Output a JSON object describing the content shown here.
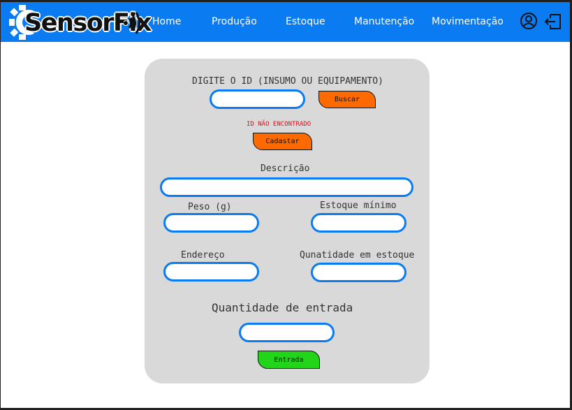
{
  "brand": {
    "name": "SensorFix"
  },
  "nav": {
    "items": [
      {
        "label": "Home"
      },
      {
        "label": "Produção"
      },
      {
        "label": "Estoque"
      },
      {
        "label": "Manutenção"
      },
      {
        "label": "Movimentação"
      }
    ],
    "icons": [
      "user-circle-icon",
      "logout-icon"
    ]
  },
  "form": {
    "id_label": "DIGITE O ID (INSUMO OU EQUIPAMENTO)",
    "id_value": "",
    "search_button": "Buscar",
    "error_message": "ID NÃO ENCONTRADO",
    "register_button": "Cadastar",
    "description_label": "Descrição",
    "description_value": "",
    "weight_label": "Peso (g)",
    "weight_value": "",
    "min_stock_label": "Estoque mínimo",
    "min_stock_value": "",
    "address_label": "Endereço",
    "address_value": "",
    "stock_qty_label": "Qunatidade em estoque",
    "stock_qty_value": "",
    "entry_qty_label": "Quantidade de entrada",
    "entry_qty_value": "",
    "entry_button": "Entrada"
  },
  "colors": {
    "nav_bg": "#0a7bf0",
    "card_bg": "#d9d9d9",
    "input_border": "#0a7bf0",
    "orange_button": "#ff6a00",
    "green_button": "#22d41a",
    "error": "#e0101a"
  }
}
